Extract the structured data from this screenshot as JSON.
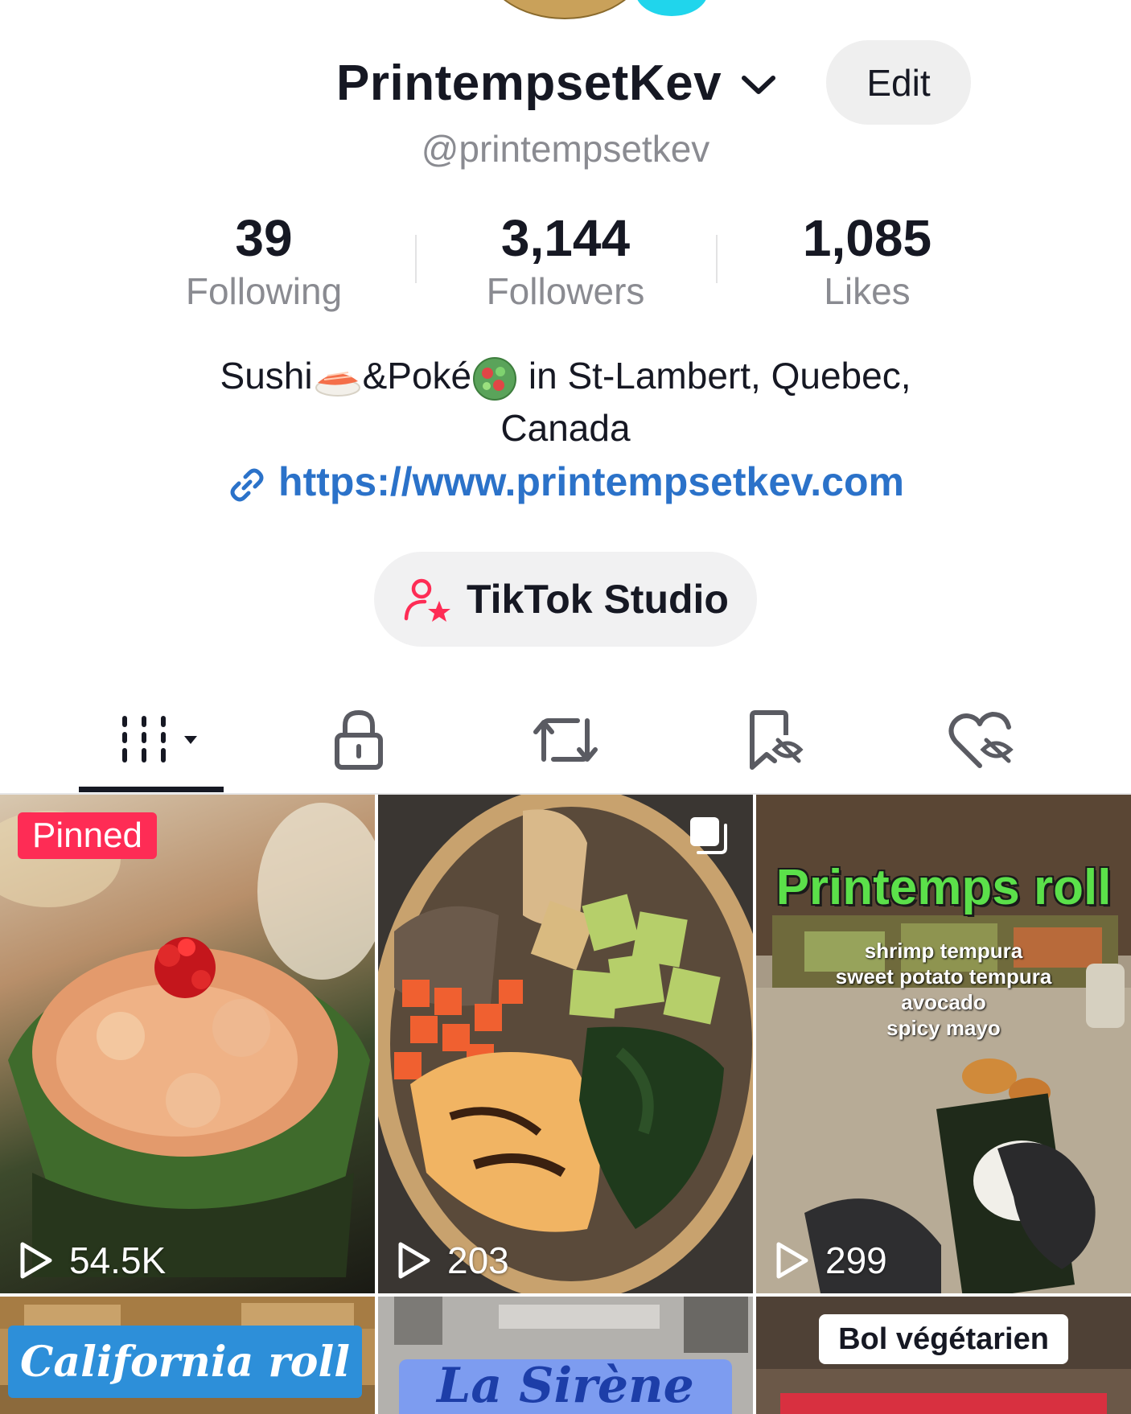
{
  "profile": {
    "display_name": "PrintempsetKev",
    "edit_label": "Edit",
    "handle": "@printempsetkev"
  },
  "stats": [
    {
      "value": "39",
      "label": "Following"
    },
    {
      "value": "3,144",
      "label": "Followers"
    },
    {
      "value": "1,085",
      "label": "Likes"
    }
  ],
  "bio": {
    "part1": "Sushi",
    "part2": "&Poké",
    "part3": " in St-Lambert, Quebec,",
    "line2": "Canada",
    "emoji_1": "sushi-emoji",
    "emoji_2": "salad-emoji"
  },
  "link": {
    "url": "https://www.printempsetkev.com"
  },
  "studio": {
    "label": "TikTok Studio"
  },
  "tabs": [
    {
      "icon": "videos-grid-icon",
      "active": true
    },
    {
      "icon": "lock-icon",
      "active": false
    },
    {
      "icon": "repost-icon",
      "active": false
    },
    {
      "icon": "favorites-hidden-icon",
      "active": false
    },
    {
      "icon": "liked-hidden-icon",
      "active": false
    }
  ],
  "videos": [
    {
      "badge": "Pinned",
      "views": "54.5K"
    },
    {
      "views": "203",
      "icon": "multi-photo-icon"
    },
    {
      "title": "Printemps roll",
      "subtitle_lines": [
        "shrimp tempura",
        "sweet potato tempura",
        "avocado",
        "spicy mayo"
      ],
      "views": "299"
    },
    {
      "title": "California roll"
    },
    {
      "title": "La Sirène"
    },
    {
      "title": "Bol végétarien"
    }
  ],
  "colors": {
    "accent_red": "#fe2c55",
    "link_blue": "#2b72c9",
    "muted_text": "#8a8b91",
    "overlay_green": "#5be04a"
  }
}
